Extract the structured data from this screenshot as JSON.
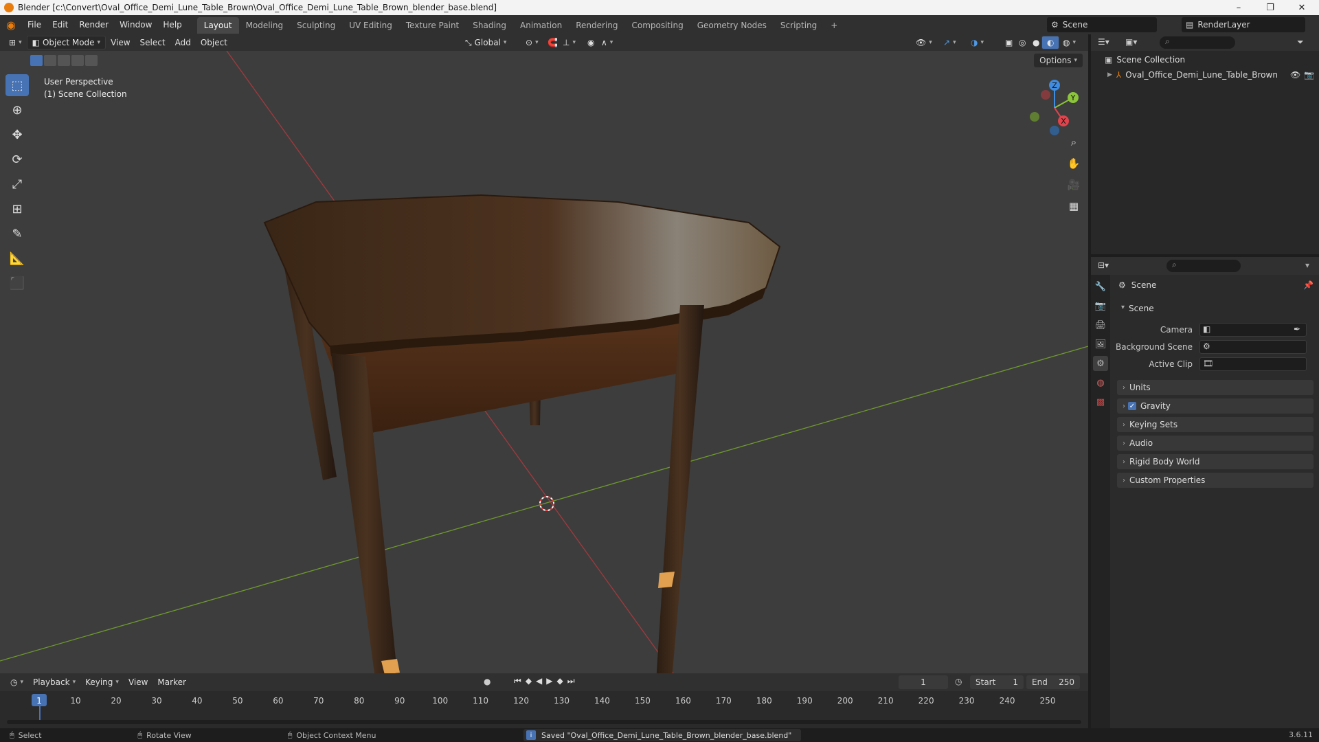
{
  "window": {
    "title": "Blender [c:\\Convert\\Oval_Office_Demi_Lune_Table_Brown\\Oval_Office_Demi_Lune_Table_Brown_blender_base.blend]",
    "minimize": "–",
    "maximize": "❐",
    "close": "✕"
  },
  "menu": [
    "File",
    "Edit",
    "Render",
    "Window",
    "Help"
  ],
  "workspaces": [
    "Layout",
    "Modeling",
    "Sculpting",
    "UV Editing",
    "Texture Paint",
    "Shading",
    "Animation",
    "Rendering",
    "Compositing",
    "Geometry Nodes",
    "Scripting",
    "+"
  ],
  "active_workspace": "Layout",
  "scene_selector": "Scene",
  "view_layer": "RenderLayer",
  "viewport_header": {
    "mode": "Object Mode",
    "menus": [
      "View",
      "Select",
      "Add",
      "Object"
    ],
    "transform": "Global",
    "options": "Options"
  },
  "viewport": {
    "perspective": "User Perspective",
    "collection": "(1) Scene Collection",
    "gizmo_axes": {
      "z": "Z",
      "y": "Y",
      "x": "X"
    }
  },
  "outliner": {
    "root": "Scene Collection",
    "items": [
      "Oval_Office_Demi_Lune_Table_Brown"
    ]
  },
  "properties": {
    "context": "Scene",
    "panel_title": "Scene",
    "fields": [
      {
        "label": "Camera"
      },
      {
        "label": "Background Scene"
      },
      {
        "label": "Active Clip"
      }
    ],
    "subpanels": [
      "Units",
      "Gravity",
      "Keying Sets",
      "Audio",
      "Rigid Body World",
      "Custom Properties"
    ],
    "gravity_checked": true
  },
  "timeline": {
    "menus": [
      "Playback",
      "Keying",
      "View",
      "Marker"
    ],
    "current_frame": "1",
    "start_label": "Start",
    "start": "1",
    "end_label": "End",
    "end": "250",
    "ticks": [
      "1",
      "10",
      "20",
      "30",
      "40",
      "50",
      "60",
      "70",
      "80",
      "90",
      "100",
      "110",
      "120",
      "130",
      "140",
      "150",
      "160",
      "170",
      "180",
      "190",
      "200",
      "210",
      "220",
      "230",
      "240",
      "250"
    ]
  },
  "statusbar": {
    "select": "Select",
    "rotate": "Rotate View",
    "context_menu": "Object Context Menu",
    "message": "Saved \"Oval_Office_Demi_Lune_Table_Brown_blender_base.blend\"",
    "version": "3.6.11"
  },
  "colors": {
    "accent": "#4772b3",
    "x_axis": "#e0434b",
    "y_axis": "#8cc43c",
    "z_axis": "#3f8ce0",
    "orange": "#e87d0d"
  }
}
